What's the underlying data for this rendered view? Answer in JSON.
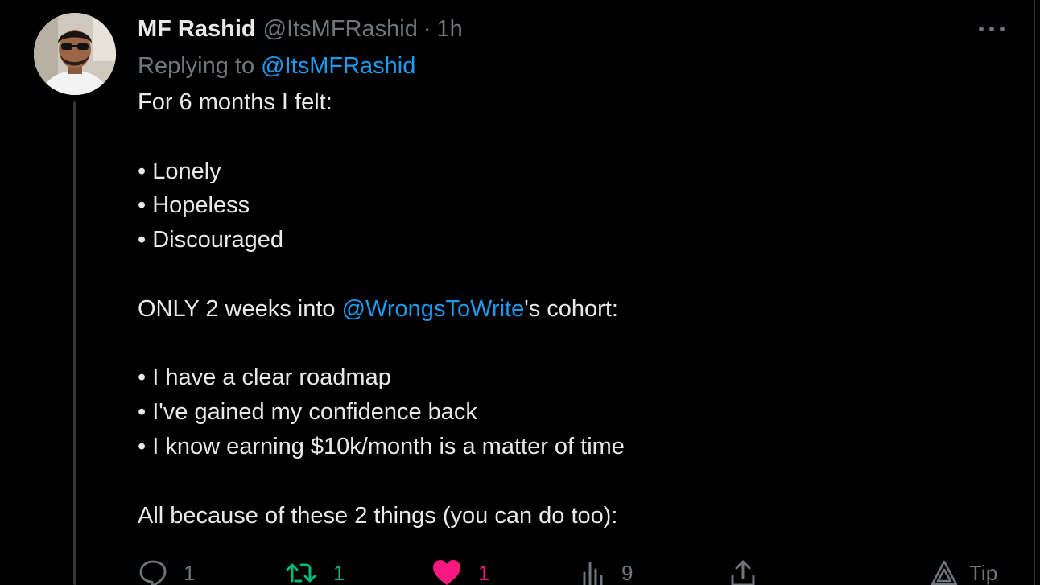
{
  "tweet": {
    "author_name": "MF Rashid",
    "author_handle": "@ItsMFRashid",
    "separator": "·",
    "time": "1h",
    "replying_prefix": "Replying to",
    "replying_handle": "@ItsMFRashid",
    "lines": {
      "l1": "For 6 months I felt:",
      "l2": "• Lonely",
      "l3": "• Hopeless",
      "l4": "• Discouraged",
      "l5_before": "ONLY 2 weeks into ",
      "l5_mention": "@WrongsToWrite",
      "l5_after": "'s cohort:",
      "l6": "• I have a clear roadmap",
      "l7": "• I've gained my confidence back",
      "l8": "• I know earning $10k/month is a matter of time",
      "l9": "All because of these 2 things (you can do too):"
    }
  },
  "actions": {
    "reply": {
      "icon": "reply-icon",
      "count": "1",
      "color": "#71767b"
    },
    "retweet": {
      "icon": "retweet-icon",
      "count": "1",
      "color": "#00ba7c"
    },
    "like": {
      "icon": "heart-icon",
      "count": "1",
      "color": "#f91880"
    },
    "views": {
      "icon": "views-icon",
      "count": "9",
      "color": "#71767b"
    },
    "share": {
      "icon": "share-icon",
      "color": "#71767b"
    },
    "tip": {
      "icon": "tip-icon",
      "label": "Tip",
      "color": "#71767b"
    }
  },
  "colors": {
    "background": "#000000",
    "text": "#e7e9ea",
    "muted": "#71767b",
    "link": "#1d9bf0",
    "thread_line": "#333639"
  }
}
